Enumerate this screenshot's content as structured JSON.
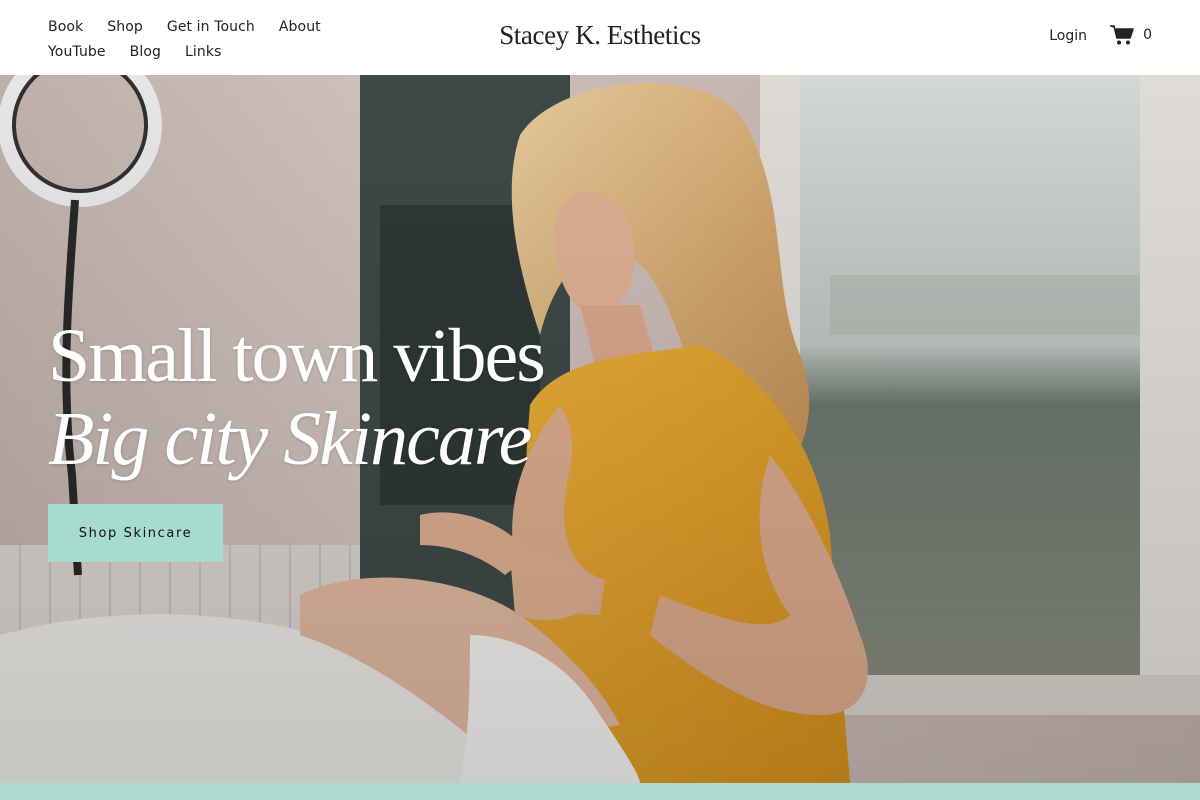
{
  "header": {
    "nav_row1": [
      {
        "label": "Book"
      },
      {
        "label": "Shop"
      },
      {
        "label": "Get in Touch"
      },
      {
        "label": "About"
      }
    ],
    "nav_row2": [
      {
        "label": "YouTube"
      },
      {
        "label": "Blog"
      },
      {
        "label": "Links"
      }
    ],
    "brand": "Stacey K. Esthetics",
    "login_label": "Login",
    "cart_count": "0",
    "cart_icon": "shopping-cart-icon"
  },
  "hero": {
    "headline_line1": "Small town vibes",
    "headline_line2": "Big city Skincare",
    "cta_label": "Shop Skincare",
    "image": "esthetician-giving-facial-photo"
  },
  "colors": {
    "accent": "#a8dbd0",
    "text": "#222222",
    "background": "#ffffff"
  }
}
